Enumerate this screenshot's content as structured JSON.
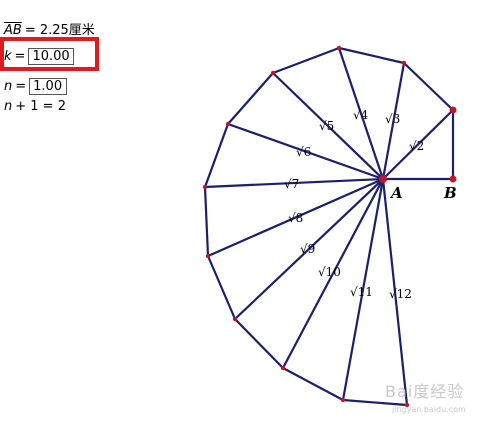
{
  "params": {
    "ab_name": "AB",
    "ab_value": "= 2.25厘米",
    "k_name": "k",
    "k_value": "10.00",
    "n_name": "n",
    "n_value": "1.00",
    "n1_name": "n",
    "n1_text": "+ 1 = 2"
  },
  "figure": {
    "point_a": "A",
    "point_b": "B",
    "labels": [
      "√2",
      "√3",
      "√4",
      "√5",
      "√6",
      "√7",
      "√8",
      "√9",
      "√10",
      "√11",
      "√12"
    ],
    "line_color": "#1a1f6e",
    "point_color": "#c0162a"
  },
  "watermark": {
    "text": "Bai度经验",
    "sub": "jingyan.baidu.com"
  }
}
